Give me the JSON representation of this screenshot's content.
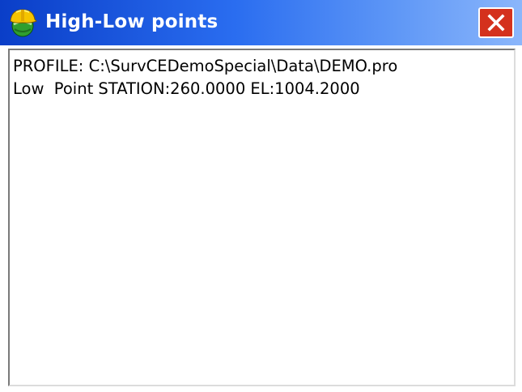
{
  "window": {
    "title": "High-Low points",
    "close_label": "Close"
  },
  "icons": {
    "app": "hardhat-globe-icon",
    "close": "close-icon"
  },
  "colors": {
    "titlebar_start": "#0a3ec8",
    "titlebar_end": "#8bb6fb",
    "close_button": "#d4311d"
  },
  "content": {
    "lines": [
      "PROFILE: C:\\SurvCEDemoSpecial\\Data\\DEMO.pro",
      "Low  Point STATION:260.0000 EL:1004.2000"
    ]
  }
}
